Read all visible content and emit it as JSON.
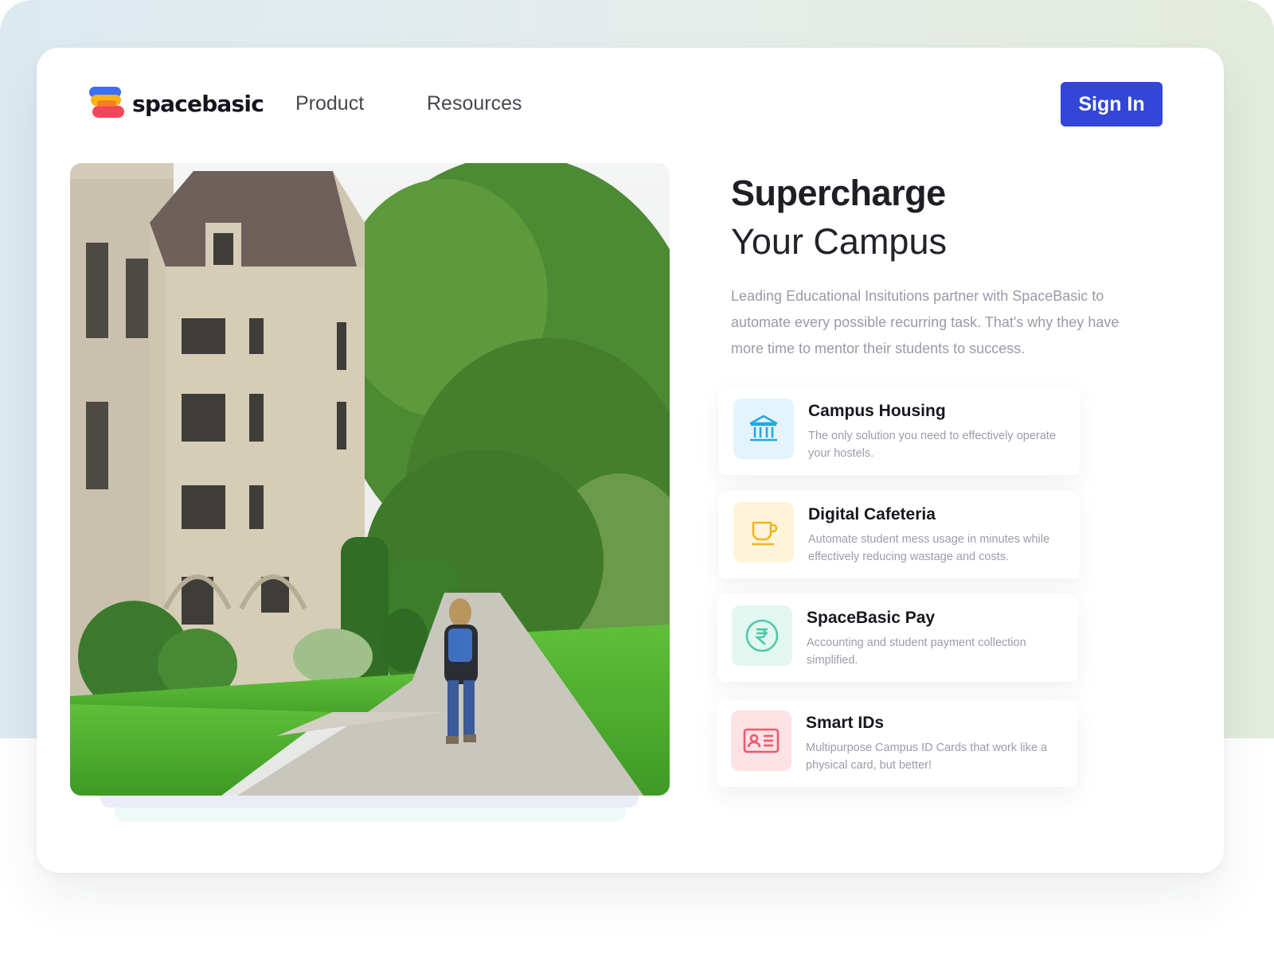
{
  "brand": {
    "name": "spacebasic"
  },
  "nav": {
    "product": "Product",
    "resources": "Resources"
  },
  "header": {
    "sign_in_label": "Sign In"
  },
  "hero": {
    "title_line1": "Supercharge",
    "title_line2": "Your Campus",
    "description": "Leading Educational Insitutions partner with SpaceBasic to automate every possible recurring task. That's why they have more time to mentor their students to success."
  },
  "features": [
    {
      "title": "Campus Housing",
      "description": "The only solution you need to effectively operate your hostels.",
      "icon": "building-icon",
      "color": "#22a6e6",
      "bg": "#e3f4fd"
    },
    {
      "title": "Digital Cafeteria",
      "description": "Automate student mess usage in minutes while effectively reducing wastage and costs.",
      "icon": "cup-icon",
      "color": "#f2b51c",
      "bg": "#fff4d9"
    },
    {
      "title": "SpaceBasic Pay",
      "description": "Accounting and student payment collection simplified.",
      "icon": "rupee-icon",
      "color": "#4fc9a9",
      "bg": "#e3f7f1"
    },
    {
      "title": "Smart IDs",
      "description": "Multipurpose Campus ID Cards that work like a physical card, but better!",
      "icon": "id-card-icon",
      "color": "#f1576d",
      "bg": "#fde2e6"
    }
  ],
  "colors": {
    "accent": "#3446d7",
    "logo": [
      "#3d6ef5",
      "#f9b314",
      "#f4455c"
    ]
  }
}
